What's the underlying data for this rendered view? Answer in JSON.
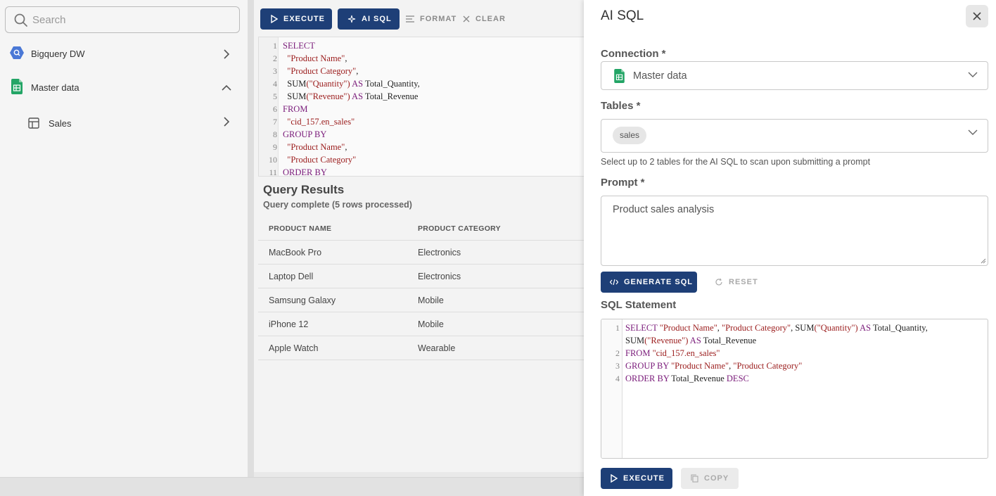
{
  "sidebar": {
    "search_placeholder": "Search",
    "items": [
      {
        "label": "Bigquery DW",
        "icon": "bigquery-icon"
      },
      {
        "label": "Master data",
        "icon": "google-sheets-icon"
      },
      {
        "label": "Sales",
        "icon": "table-icon"
      }
    ]
  },
  "toolbar": {
    "execute_label": "EXECUTE",
    "ai_sql_label": "AI SQL",
    "format_label": "FORMAT",
    "clear_label": "CLEAR"
  },
  "editor": {
    "line_numbers": [
      "1",
      "2",
      "3",
      "4",
      "5",
      "6",
      "7",
      "8",
      "9",
      "10",
      "11"
    ]
  },
  "results": {
    "title": "Query Results",
    "status": "Query complete (5 rows processed)",
    "columns": [
      "PRODUCT NAME",
      "PRODUCT CATEGORY"
    ],
    "rows": [
      [
        "MacBook Pro",
        "Electronics"
      ],
      [
        "Laptop Dell",
        "Electronics"
      ],
      [
        "Samsung Galaxy",
        "Mobile"
      ],
      [
        "iPhone 12",
        "Mobile"
      ],
      [
        "Apple Watch",
        "Wearable"
      ]
    ]
  },
  "panel": {
    "title": "AI SQL",
    "connection_label": "Connection *",
    "connection_value": "Master data",
    "tables_label": "Tables *",
    "tables_chip": "sales",
    "tables_helper": "Select up to 2 tables for the AI SQL to scan upon submitting a prompt",
    "prompt_label": "Prompt *",
    "prompt_value": "Product sales analysis",
    "generate_label": "GENERATE SQL",
    "reset_label": "RESET",
    "sql_label": "SQL Statement",
    "sql_line_numbers": [
      "1",
      "",
      "2",
      "3",
      "4"
    ],
    "execute_label": "EXECUTE",
    "copy_label": "COPY"
  },
  "colors": {
    "primary": "#1e3f77",
    "keyword": "#7a1b7a",
    "string": "#9b1c1c"
  }
}
